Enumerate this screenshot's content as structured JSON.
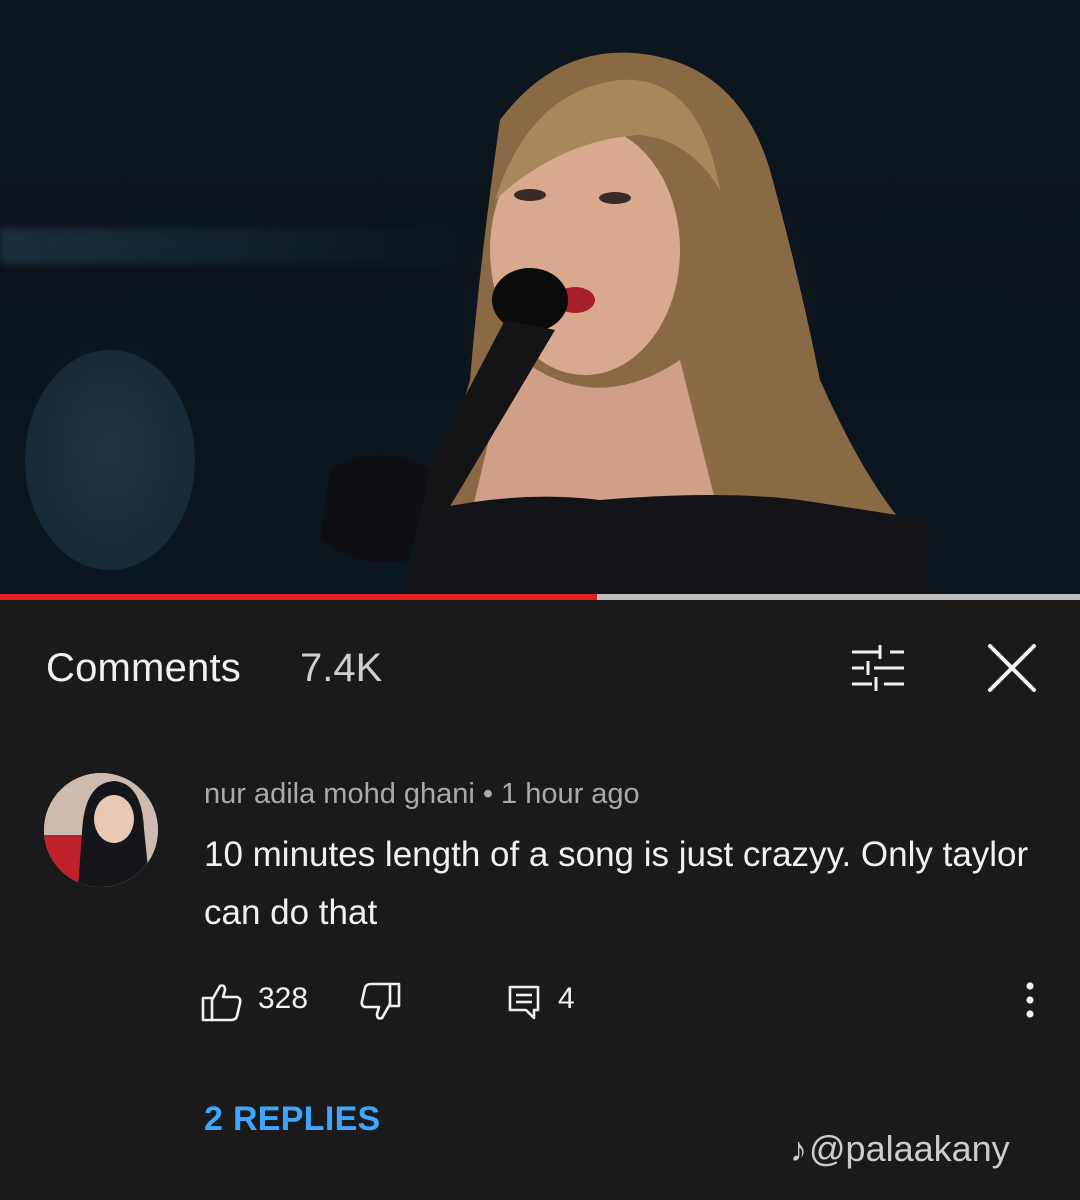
{
  "player": {
    "progress_fraction": 0.553,
    "played_color": "#e02020",
    "buffer_color": "#bdbdbd"
  },
  "comments_panel": {
    "title": "Comments",
    "count": "7.4K",
    "sort_icon": "sliders-icon",
    "close_icon": "close-icon"
  },
  "comment": {
    "author": "nur adila mohd ghani",
    "separator": "•",
    "time": "1 hour ago",
    "text": "10 minutes length of a song is just crazyy. Only taylor can do that",
    "likes": "328",
    "reply_count": "4",
    "replies_link": "2 REPLIES",
    "avatar_icon": "user-avatar",
    "like_icon": "thumbs-up-icon",
    "dislike_icon": "thumbs-down-icon",
    "reply_icon": "comment-icon",
    "more_icon": "more-vertical-icon",
    "link_color": "#3ea6ff"
  },
  "watermark": {
    "handle": "@palaakany",
    "icon": "tiktok-icon"
  }
}
